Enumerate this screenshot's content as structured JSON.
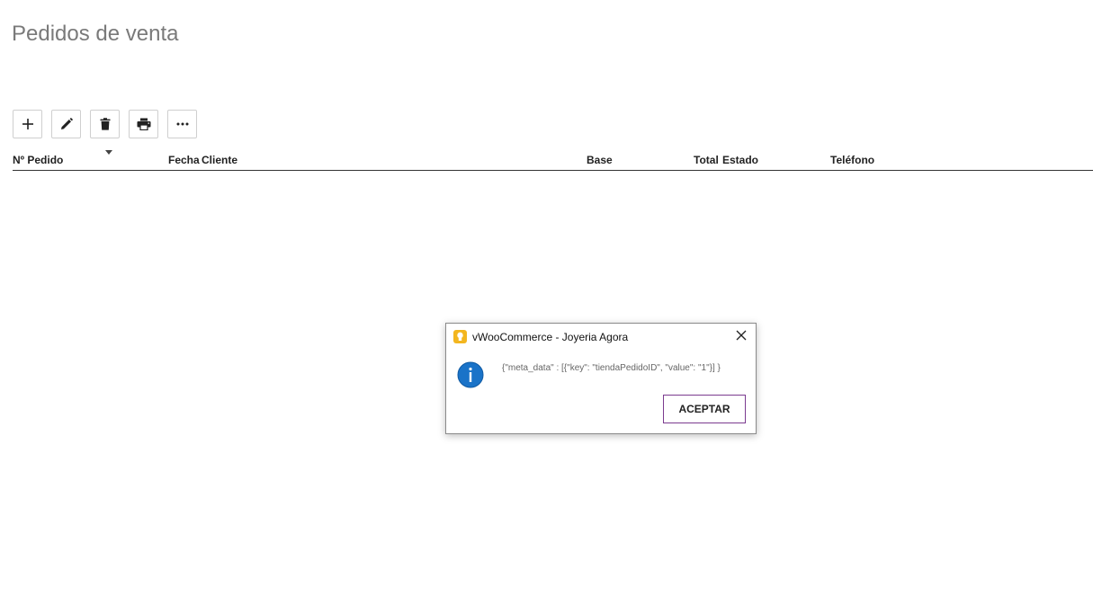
{
  "page": {
    "title": "Pedidos de venta"
  },
  "toolbar": {
    "buttons": [
      {
        "name": "add",
        "icon": "plus-icon"
      },
      {
        "name": "edit",
        "icon": "pencil-icon"
      },
      {
        "name": "delete",
        "icon": "trash-icon"
      },
      {
        "name": "print",
        "icon": "printer-icon"
      },
      {
        "name": "more",
        "icon": "ellipsis-icon"
      }
    ]
  },
  "grid": {
    "columns": [
      "Nº Pedido",
      "Fecha",
      "Cliente",
      "Base",
      "Total",
      "Estado",
      "Teléfono"
    ],
    "sorted_column_icon": "sort-down-icon"
  },
  "dialog": {
    "title": "vWooCommerce - Joyeria Agora",
    "app_icon": "app-icon",
    "message_icon": "info-icon",
    "message": "{\"meta_data\" : [{\"key\": \"tiendaPedidoID\", \"value\": \"1\"}] }",
    "accept_label": "ACEPTAR",
    "close_icon": "close-icon"
  },
  "colors": {
    "title_gray": "#7a7a7a",
    "info_blue": "#1a73c8",
    "accent_purple": "#7b3b8f",
    "app_icon_yellow": "#f3b61f"
  }
}
